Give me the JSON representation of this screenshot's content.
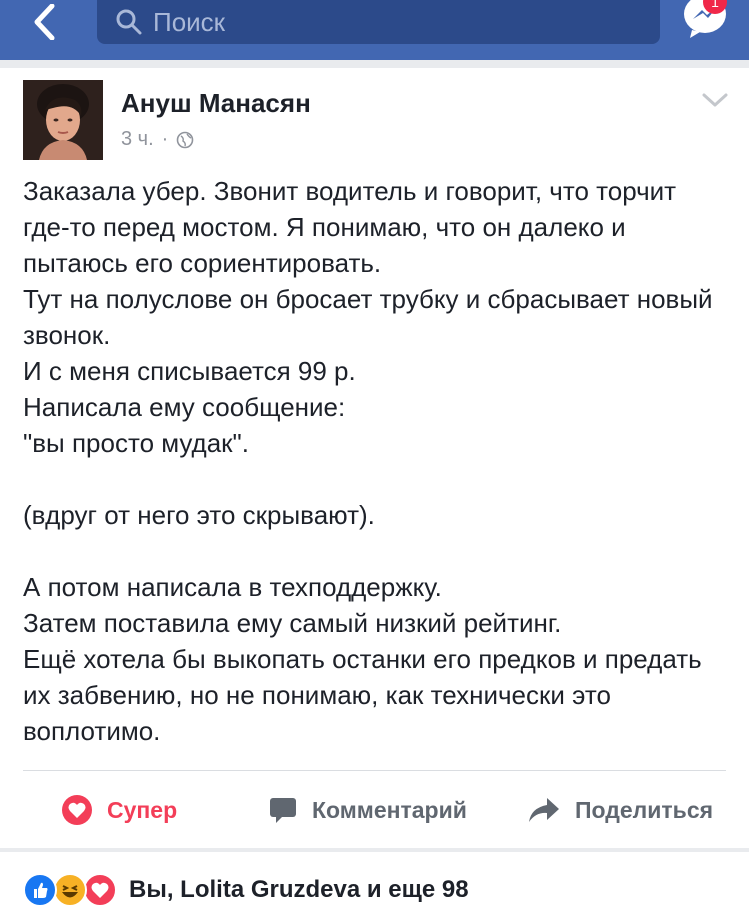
{
  "nav": {
    "search_placeholder": "Поиск",
    "messenger_badge": "1"
  },
  "post": {
    "author": "Ануш Манасян",
    "time": "3 ч.",
    "separator": "·",
    "text": "Заказала убер. Звонит водитель и говорит, что торчит где-то перед мостом. Я понимаю, что он далеко и пытаюсь его сориентировать.\nТут на полуслове он бросает трубку и сбрасывает новый звонок.\nИ с меня списывается 99 р.\nНаписала ему сообщение:\n\"вы просто мудак\".\n\n(вдруг от него это скрывают).\n\nА потом написала в техподдержку.\nЗатем поставила ему самый низкий рейтинг.\nЕщё хотела бы выкопать останки его предков и предать их забвению, но не понимаю, как технически это воплотимо."
  },
  "actions": {
    "super": "Супер",
    "comment": "Комментарий",
    "share": "Поделиться"
  },
  "reactions": {
    "summary": "Вы, Lolita Gruzdeva и еще 98"
  },
  "colors": {
    "nav_bg": "#4267b2",
    "super_red": "#f33e58",
    "like_blue": "#1877f2",
    "haha_yellow": "#f7b125"
  }
}
